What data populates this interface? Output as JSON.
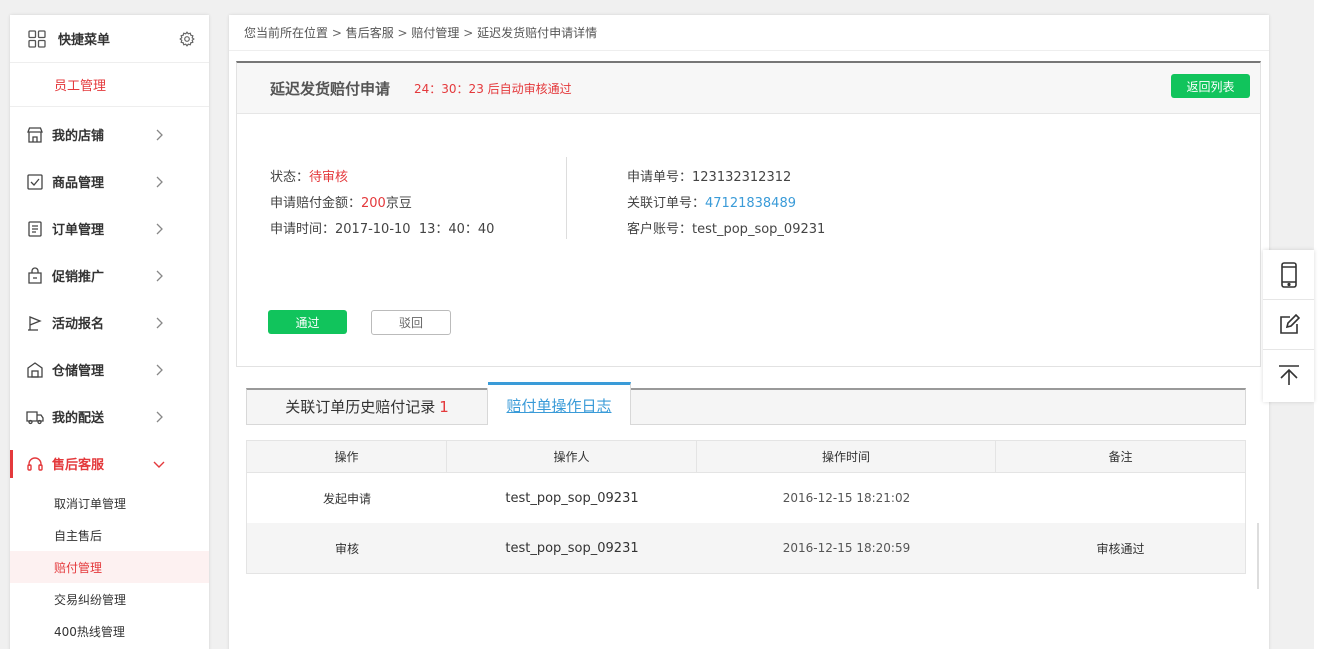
{
  "sidebar": {
    "quick_menu_label": "快捷菜单",
    "quick_sub_label": "员工管理",
    "items": [
      {
        "label": "我的店铺",
        "icon": "store-icon"
      },
      {
        "label": "商品管理",
        "icon": "goods-icon"
      },
      {
        "label": "订单管理",
        "icon": "order-icon"
      },
      {
        "label": "促销推广",
        "icon": "promotion-icon"
      },
      {
        "label": "活动报名",
        "icon": "activity-icon"
      },
      {
        "label": "仓储管理",
        "icon": "warehouse-icon"
      },
      {
        "label": "我的配送",
        "icon": "delivery-icon"
      },
      {
        "label": "售后客服",
        "icon": "headset-icon"
      }
    ],
    "subitems": [
      "取消订单管理",
      "自主售后",
      "赔付管理",
      "交易纠纷管理",
      "400热线管理"
    ],
    "accent_color": "#e4393c"
  },
  "breadcrumb": [
    "您当前所在位置",
    "售后客服",
    "赔付管理",
    "延迟发货赔付申请详情"
  ],
  "detail": {
    "title": "延迟发货赔付申请",
    "timer_text": "24：30：23 后自动审核通过",
    "back_label": "返回列表",
    "status_label": "状态：",
    "status_value": "待审核",
    "amount_label": "申请赔付金额：",
    "amount_value": "200",
    "amount_unit": "京豆",
    "time_label": "申请时间：",
    "time_value": "2017-10-10  13：40：40",
    "apply_no_label": "申请单号：",
    "apply_no_value": "123132312312",
    "order_no_label": "关联订单号：",
    "order_no_value": "47121838489",
    "account_label": "客户账号：",
    "account_value": "test_pop_sop_09231",
    "pass_label": "通过",
    "reject_label": "驳回",
    "button_color": "#11c45c"
  },
  "tabs": {
    "history_label": "关联订单历史赔付记录",
    "history_count": "1",
    "log_label": "赔付单操作日志"
  },
  "log_table": {
    "headers": [
      "操作",
      "操作人",
      "操作时间",
      "备注"
    ],
    "rows": [
      [
        "发起申请",
        "test_pop_sop_09231",
        "2016-12-15 18:21:02",
        ""
      ],
      [
        "审核",
        "test_pop_sop_09231",
        "2016-12-15 18:20:59",
        "审核通过"
      ]
    ]
  },
  "float_tools": [
    "phone-icon",
    "edit-icon",
    "back-to-top-icon"
  ]
}
